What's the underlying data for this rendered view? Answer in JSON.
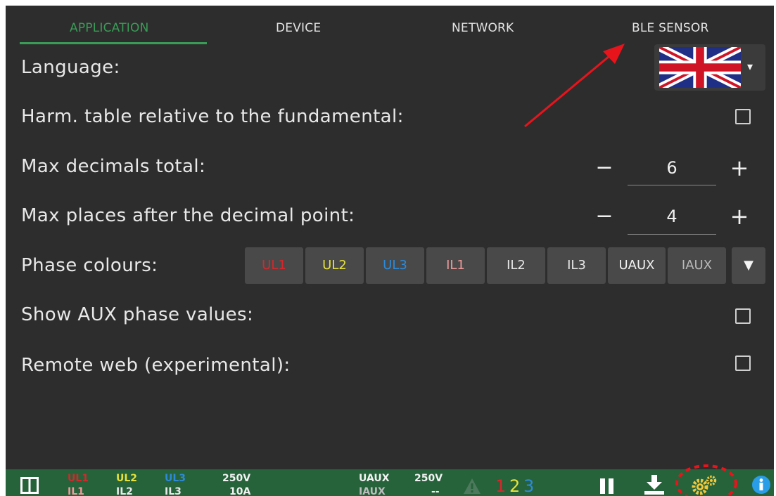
{
  "tabs": [
    {
      "label": "APPLICATION",
      "active": true
    },
    {
      "label": "DEVICE",
      "active": false
    },
    {
      "label": "NETWORK",
      "active": false
    },
    {
      "label": "BLE SENSOR",
      "active": false
    }
  ],
  "settings": {
    "language": {
      "label": "Language:",
      "value_icon": "uk-flag-icon",
      "caret": "▾"
    },
    "harm_table": {
      "label": "Harm. table relative to the fundamental:",
      "checked": false
    },
    "max_decimals": {
      "label": "Max decimals total:",
      "minus": "−",
      "value": "6",
      "plus": "+"
    },
    "max_places": {
      "label": "Max places after the decimal point:",
      "minus": "−",
      "value": "4",
      "plus": "+"
    },
    "phase_colours": {
      "label": "Phase colours:",
      "buttons": [
        {
          "label": "UL1",
          "color": "#d8262b"
        },
        {
          "label": "UL2",
          "color": "#e6e23a"
        },
        {
          "label": "UL3",
          "color": "#2d8ad8"
        },
        {
          "label": "IL1",
          "color": "#ef9a9a"
        },
        {
          "label": "IL2",
          "color": "#e8e8e8"
        },
        {
          "label": "IL3",
          "color": "#e8e8e8"
        },
        {
          "label": "UAUX",
          "color": "#f2f2f2"
        },
        {
          "label": "IAUX",
          "color": "#b9b9b9"
        }
      ],
      "dropdown": "▼"
    },
    "show_aux": {
      "label": "Show AUX phase values:",
      "checked": false
    },
    "remote_web": {
      "label": "Remote web (experimental):",
      "checked": false
    }
  },
  "statusbar": {
    "ul1": "UL1",
    "ul2": "UL2",
    "ul3": "UL3",
    "il1": "IL1",
    "il2": "IL2",
    "il3": "IL3",
    "volt_range": "250V",
    "amp_range": "10A",
    "uaux": "UAUX",
    "iaux": "IAUX",
    "aux_volt_range": "250V",
    "aux_amp_range": "--",
    "phase_seq": [
      "1",
      "2",
      "3"
    ],
    "phase_seq_colors": [
      "#d8262b",
      "#e6e23a",
      "#2d8ad8"
    ],
    "icons": [
      "layout-icon",
      "warning-icon",
      "pause-icon",
      "download-icon",
      "settings-gears-icon",
      "info-icon"
    ]
  },
  "colors": {
    "background": "#2d2d2d",
    "accent": "#3a9c57",
    "statusbar": "#26623a",
    "annotation": "#e8141c"
  }
}
